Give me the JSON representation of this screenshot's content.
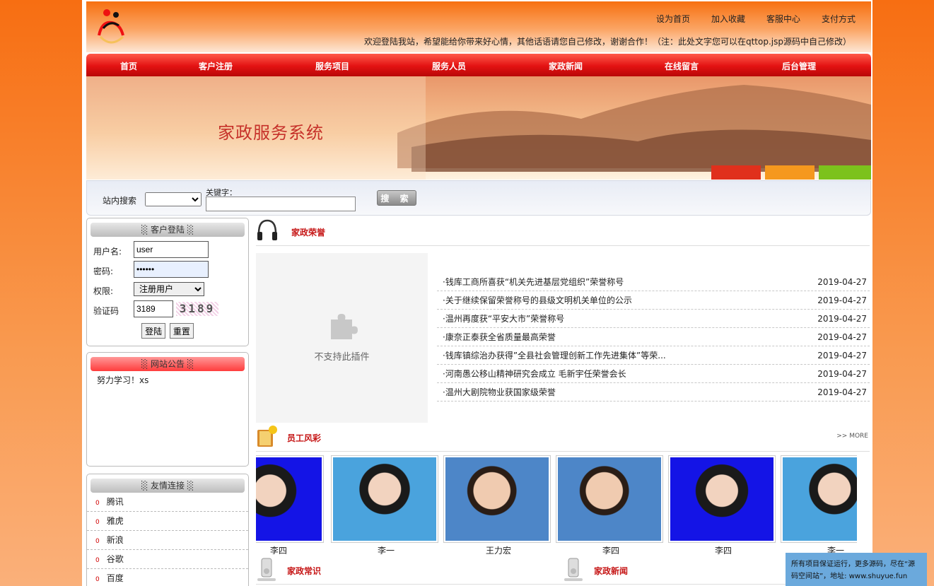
{
  "header": {
    "links": [
      "设为首页",
      "加入收藏",
      "客服中心",
      "支付方式"
    ],
    "welcome": "欢迎登陆我站，希望能给你带来好心情，其他话语请您自己修改，谢谢合作！（注：此处文字您可以在qttop.jsp源码中自己修改）"
  },
  "nav": [
    "首页",
    "客户注册",
    "服务项目",
    "服务人员",
    "家政新闻",
    "在线留言",
    "后台管理"
  ],
  "banner": {
    "title": "家政服务系统"
  },
  "search": {
    "label": "站内搜索",
    "keyword_label": "关键字：",
    "button": "搜 索"
  },
  "login": {
    "title": "客户登陆",
    "username_label": "用户名:",
    "username_value": "user",
    "password_label": "密码:",
    "password_value": "••••••",
    "role_label": "权限:",
    "role_value": "注册用户",
    "captcha_label": "验证码",
    "captcha_value": "3189",
    "captcha_image": "3189",
    "login_button": "登陆",
    "reset_button": "重置"
  },
  "notice": {
    "title": "网站公告",
    "text": "努力学习！xs"
  },
  "links": {
    "title": "友情连接",
    "items": [
      "腾讯",
      "雅虎",
      "新浪",
      "谷歌",
      "百度"
    ]
  },
  "honor": {
    "title": "家政荣誉",
    "plugin_text": "不支持此插件",
    "items": [
      {
        "title": "·钱库工商所喜获“机关先进基层党组织”荣誉称号",
        "date": "2019-04-27"
      },
      {
        "title": "·关于继续保留荣誉称号的县级文明机关单位的公示",
        "date": "2019-04-27"
      },
      {
        "title": "·温州再度获“平安大市”荣誉称号",
        "date": "2019-04-27"
      },
      {
        "title": "·康奈正泰获全省质量最高荣誉",
        "date": "2019-04-27"
      },
      {
        "title": "·钱库镇综治办获得”全县社会管理创新工作先进集体”等荣...",
        "date": "2019-04-27"
      },
      {
        "title": "·河南愚公移山精神研究会成立 毛新宇任荣誉会长",
        "date": "2019-04-27"
      },
      {
        "title": "·温州大剧院物业获国家级荣誉",
        "date": "2019-04-27"
      }
    ]
  },
  "staff": {
    "title": "员工风彩",
    "more": ">> MORE",
    "people": [
      "李四",
      "李一",
      "王力宏",
      "李四",
      "李四",
      "李一"
    ]
  },
  "bottom": {
    "knowledge_title": "家政常识",
    "news_title": "家政新闻"
  },
  "watermark": "所有项目保证运行，更多源码，尽在“源码空间站”，地址: www.shuyue.fun",
  "colors": {
    "nav_red": "#e31212",
    "accent_orange": "#f77519",
    "title_red": "#c61717"
  }
}
